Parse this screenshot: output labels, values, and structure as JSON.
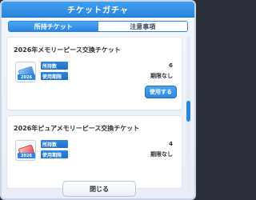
{
  "dialog": {
    "title": "チケットガチャ",
    "tabs": [
      {
        "label": "所持チケット"
      },
      {
        "label": "注意事項"
      }
    ],
    "close_label": "閉じる"
  },
  "tickets": [
    {
      "title": "2026年メモリーピース交換チケット",
      "icon_tag": "2026",
      "fields": [
        {
          "label": "所持数",
          "value": "6"
        },
        {
          "label": "使用期限",
          "value": "期限なし"
        }
      ],
      "use_label": "使用する"
    },
    {
      "title": "2026年ピュアメモリーピース交換チケット",
      "icon_tag": "2026",
      "fields": [
        {
          "label": "所持数",
          "value": "4"
        },
        {
          "label": "使用期限",
          "value": "期限なし"
        }
      ]
    }
  ]
}
